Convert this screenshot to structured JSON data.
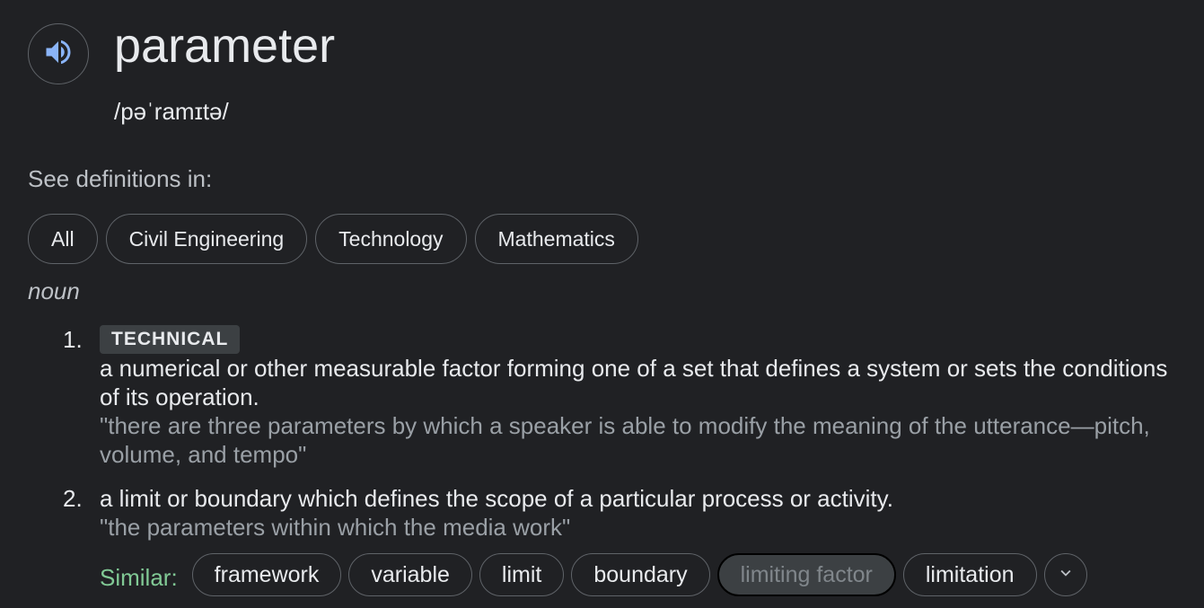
{
  "entry": {
    "word": "parameter",
    "phonetic": "/pəˈramɪtə/",
    "speaker_icon": "volume-up-icon",
    "accent_color": "#8ab4f8"
  },
  "see_definitions": {
    "label": "See definitions in:",
    "chips": [
      "All",
      "Civil Engineering",
      "Technology",
      "Mathematics"
    ]
  },
  "part_of_speech": "noun",
  "definitions": [
    {
      "number": "1.",
      "tag": "TECHNICAL",
      "text": "a numerical or other measurable factor forming one of a set that defines a system or sets the conditions of its operation.",
      "example": "\"there are three parameters by which a speaker is able to modify the meaning of the utterance—pitch, volume, and tempo\""
    },
    {
      "number": "2.",
      "text": "a limit or boundary which defines the scope of a particular process or activity.",
      "example": "\"the parameters within which the media work\""
    }
  ],
  "similar": {
    "label": "Similar:",
    "label_color": "#81c995",
    "words": [
      "framework",
      "variable",
      "limit",
      "boundary",
      "limiting factor",
      "limitation"
    ],
    "selected": "limiting factor",
    "expand_icon": "chevron-down-icon"
  }
}
